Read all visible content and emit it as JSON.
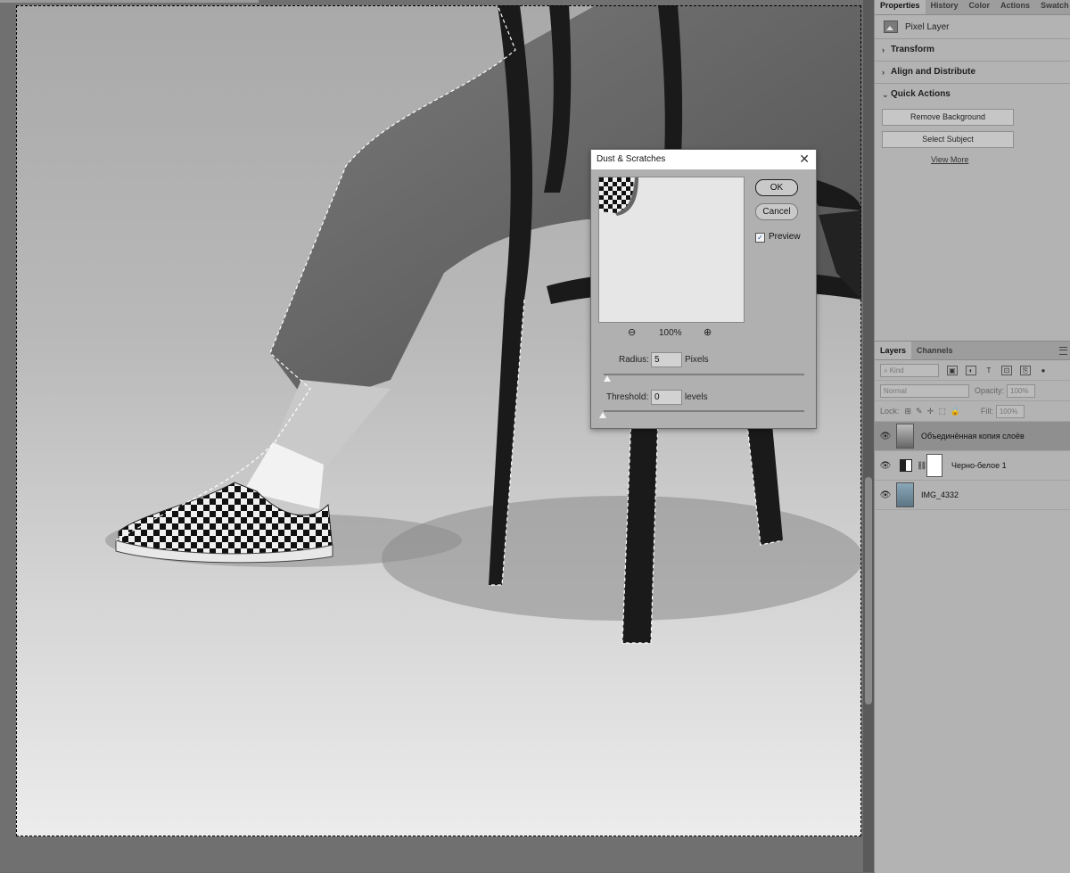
{
  "properties_panel": {
    "tabs": [
      {
        "label": "Properties"
      },
      {
        "label": "History"
      },
      {
        "label": "Color"
      },
      {
        "label": "Actions"
      },
      {
        "label": "Swatch"
      }
    ],
    "layer_kind": "Pixel Layer",
    "sections": {
      "transform": "Transform",
      "align": "Align and Distribute",
      "quick_actions": "Quick Actions"
    },
    "buttons": {
      "remove_background": "Remove Background",
      "select_subject": "Select Subject"
    },
    "view_more": "View More"
  },
  "layers_panel": {
    "tabs": [
      {
        "label": "Layers"
      },
      {
        "label": "Channels"
      }
    ],
    "filter_kind": "Kind",
    "blend_mode": "Normal",
    "opacity_label": "Opacity:",
    "opacity_value": "100%",
    "lock_label": "Lock:",
    "fill_label": "Fill:",
    "fill_value": "100%",
    "layers": [
      {
        "name": "Объединённая копия слоёв"
      },
      {
        "name": "Черно-белое 1"
      },
      {
        "name": "IMG_4332"
      }
    ]
  },
  "dialog": {
    "title": "Dust & Scratches",
    "close_glyph": "✕",
    "ok_label": "OK",
    "cancel_label": "Cancel",
    "preview_label": "Preview",
    "preview_checked_glyph": "✓",
    "zoom_level": "100%",
    "zoom_out_glyph": "⊖",
    "zoom_in_glyph": "⊕",
    "radius_label": "Radius:",
    "radius_value": "5",
    "radius_unit": "Pixels",
    "threshold_label": "Threshold:",
    "threshold_value": "0",
    "threshold_unit": "levels"
  },
  "colors": {
    "panel_bg": "#b3b3b3",
    "selected_layer": "#8f8f8f",
    "canvas_workspace": "#707070",
    "check_accent": "#1a55a8"
  },
  "icons": {
    "eye": "eye-icon",
    "chevron": "chevron-right-icon",
    "chevron_open": "chevron-down-icon"
  }
}
